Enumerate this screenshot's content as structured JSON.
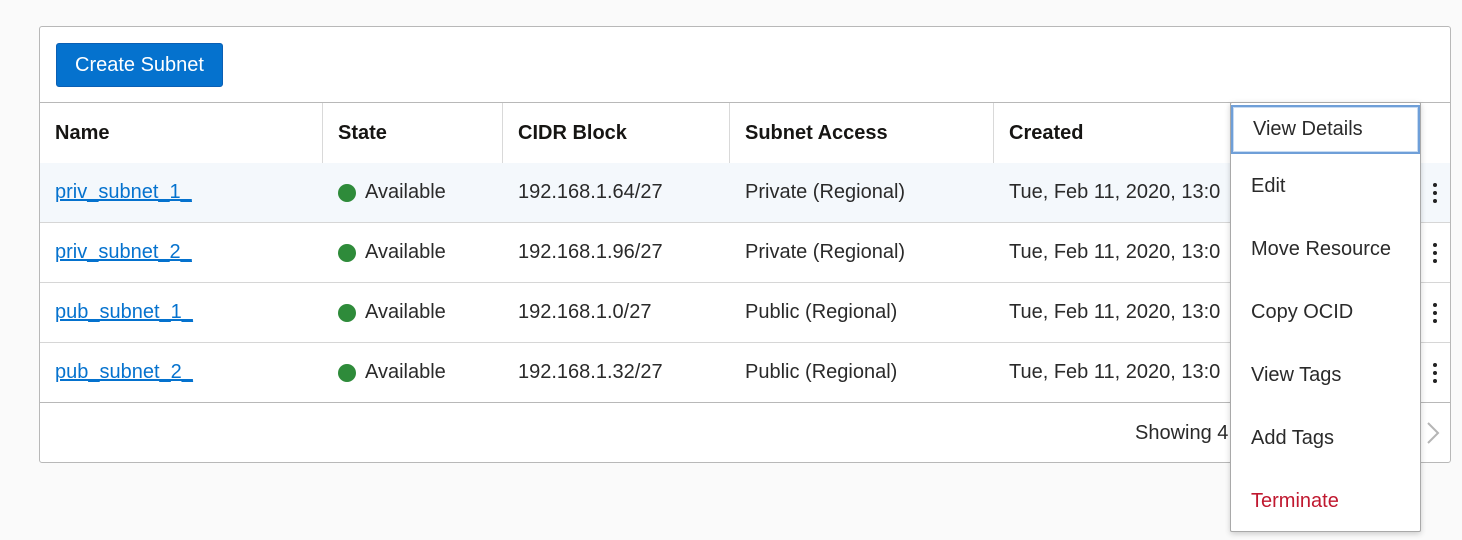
{
  "toolbar": {
    "create_label": "Create Subnet"
  },
  "table": {
    "columns": [
      "Name",
      "State",
      "CIDR Block",
      "Subnet Access",
      "Created"
    ],
    "rows": [
      {
        "name": "priv_subnet_1_",
        "state": "Available",
        "cidr": "192.168.1.64/27",
        "access": "Private (Regional)",
        "created": "Tue, Feb 11, 2020, 13:0"
      },
      {
        "name": "priv_subnet_2_",
        "state": "Available",
        "cidr": "192.168.1.96/27",
        "access": "Private (Regional)",
        "created": "Tue, Feb 11, 2020, 13:0"
      },
      {
        "name": "pub_subnet_1_",
        "state": "Available",
        "cidr": "192.168.1.0/27",
        "access": "Public (Regional)",
        "created": "Tue, Feb 11, 2020, 13:0"
      },
      {
        "name": "pub_subnet_2_",
        "state": "Available",
        "cidr": "192.168.1.32/27",
        "access": "Public (Regional)",
        "created": "Tue, Feb 11, 2020, 13:0"
      }
    ],
    "status_color": "#2e8b3a"
  },
  "footer": {
    "showing_text": "Showing 4"
  },
  "action_menu": {
    "items": [
      "View Details",
      "Edit",
      "Move Resource",
      "Copy OCID",
      "View Tags",
      "Add Tags",
      "Terminate"
    ]
  },
  "colors": {
    "primary": "#0572ce",
    "danger": "#c0182f"
  }
}
